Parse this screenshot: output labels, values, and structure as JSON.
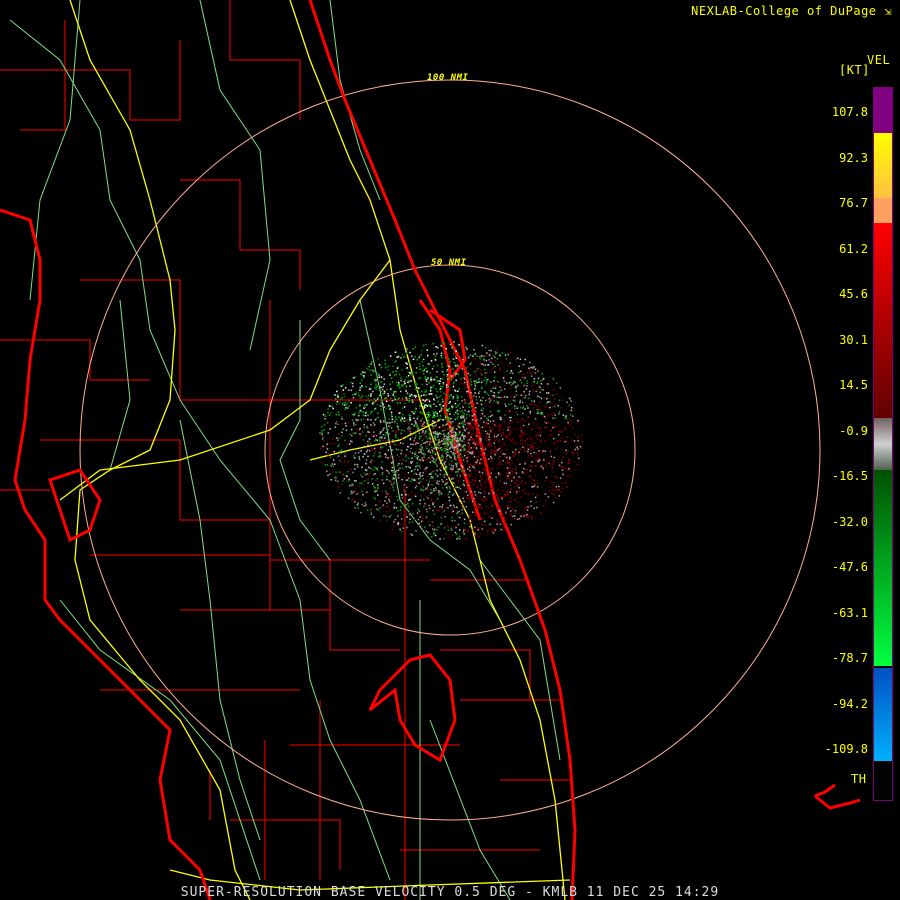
{
  "header": {
    "credit": "NEXLAB-College of DuPage",
    "credit_icon": "external-link-icon"
  },
  "legend": {
    "product": "VEL",
    "units": "[KT]",
    "ticks": [
      "107.8",
      "92.3",
      "76.7",
      "61.2",
      "45.6",
      "30.1",
      "14.5",
      "-0.9",
      "-16.5",
      "-32.0",
      "-47.6",
      "-63.1",
      "-78.7",
      "-94.2",
      "-109.8"
    ],
    "th_label": "TH",
    "colors": {
      "purple": "#800080",
      "yellow": "#ffff00",
      "orange": "#ffa060",
      "red": "#ff0000",
      "dark_red": "#600000",
      "gray": "#c8c8c8",
      "green": "#00c000",
      "dark_green": "#005000",
      "blue": "#0050c0",
      "cyan": "#00b0ff"
    }
  },
  "map": {
    "range_rings": [
      {
        "label": "50 NMI"
      },
      {
        "label": "100 NMI"
      }
    ],
    "colors": {
      "coast": "#ff0000",
      "county": "#ff0000",
      "highway": "#ffff00",
      "roads": "#90ee90",
      "ring": "#ffb090"
    }
  },
  "footer": {
    "caption": "SUPER-RESOLUTION BASE VELOCITY 0.5 DEG - KMLB 11 DEC 25 14:29"
  }
}
